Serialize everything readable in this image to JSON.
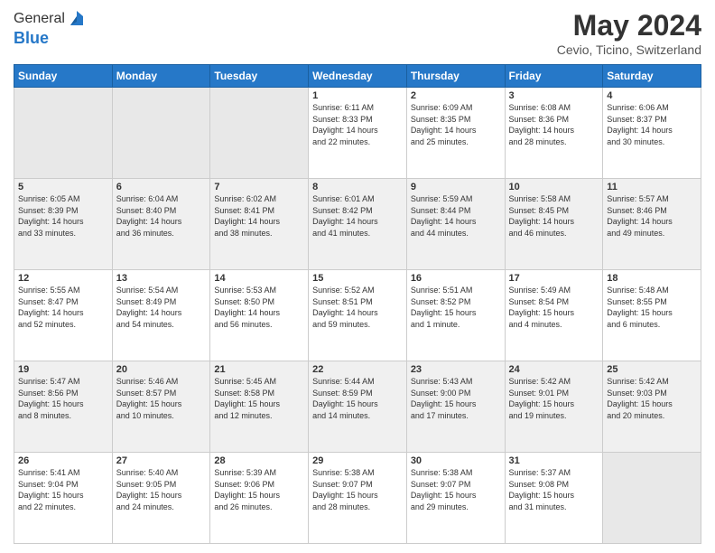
{
  "logo": {
    "line1": "General",
    "line2": "Blue"
  },
  "title": "May 2024",
  "subtitle": "Cevio, Ticino, Switzerland",
  "days_of_week": [
    "Sunday",
    "Monday",
    "Tuesday",
    "Wednesday",
    "Thursday",
    "Friday",
    "Saturday"
  ],
  "weeks": [
    [
      {
        "day": "",
        "info": ""
      },
      {
        "day": "",
        "info": ""
      },
      {
        "day": "",
        "info": ""
      },
      {
        "day": "1",
        "info": "Sunrise: 6:11 AM\nSunset: 8:33 PM\nDaylight: 14 hours\nand 22 minutes."
      },
      {
        "day": "2",
        "info": "Sunrise: 6:09 AM\nSunset: 8:35 PM\nDaylight: 14 hours\nand 25 minutes."
      },
      {
        "day": "3",
        "info": "Sunrise: 6:08 AM\nSunset: 8:36 PM\nDaylight: 14 hours\nand 28 minutes."
      },
      {
        "day": "4",
        "info": "Sunrise: 6:06 AM\nSunset: 8:37 PM\nDaylight: 14 hours\nand 30 minutes."
      }
    ],
    [
      {
        "day": "5",
        "info": "Sunrise: 6:05 AM\nSunset: 8:39 PM\nDaylight: 14 hours\nand 33 minutes."
      },
      {
        "day": "6",
        "info": "Sunrise: 6:04 AM\nSunset: 8:40 PM\nDaylight: 14 hours\nand 36 minutes."
      },
      {
        "day": "7",
        "info": "Sunrise: 6:02 AM\nSunset: 8:41 PM\nDaylight: 14 hours\nand 38 minutes."
      },
      {
        "day": "8",
        "info": "Sunrise: 6:01 AM\nSunset: 8:42 PM\nDaylight: 14 hours\nand 41 minutes."
      },
      {
        "day": "9",
        "info": "Sunrise: 5:59 AM\nSunset: 8:44 PM\nDaylight: 14 hours\nand 44 minutes."
      },
      {
        "day": "10",
        "info": "Sunrise: 5:58 AM\nSunset: 8:45 PM\nDaylight: 14 hours\nand 46 minutes."
      },
      {
        "day": "11",
        "info": "Sunrise: 5:57 AM\nSunset: 8:46 PM\nDaylight: 14 hours\nand 49 minutes."
      }
    ],
    [
      {
        "day": "12",
        "info": "Sunrise: 5:55 AM\nSunset: 8:47 PM\nDaylight: 14 hours\nand 52 minutes."
      },
      {
        "day": "13",
        "info": "Sunrise: 5:54 AM\nSunset: 8:49 PM\nDaylight: 14 hours\nand 54 minutes."
      },
      {
        "day": "14",
        "info": "Sunrise: 5:53 AM\nSunset: 8:50 PM\nDaylight: 14 hours\nand 56 minutes."
      },
      {
        "day": "15",
        "info": "Sunrise: 5:52 AM\nSunset: 8:51 PM\nDaylight: 14 hours\nand 59 minutes."
      },
      {
        "day": "16",
        "info": "Sunrise: 5:51 AM\nSunset: 8:52 PM\nDaylight: 15 hours\nand 1 minute."
      },
      {
        "day": "17",
        "info": "Sunrise: 5:49 AM\nSunset: 8:54 PM\nDaylight: 15 hours\nand 4 minutes."
      },
      {
        "day": "18",
        "info": "Sunrise: 5:48 AM\nSunset: 8:55 PM\nDaylight: 15 hours\nand 6 minutes."
      }
    ],
    [
      {
        "day": "19",
        "info": "Sunrise: 5:47 AM\nSunset: 8:56 PM\nDaylight: 15 hours\nand 8 minutes."
      },
      {
        "day": "20",
        "info": "Sunrise: 5:46 AM\nSunset: 8:57 PM\nDaylight: 15 hours\nand 10 minutes."
      },
      {
        "day": "21",
        "info": "Sunrise: 5:45 AM\nSunset: 8:58 PM\nDaylight: 15 hours\nand 12 minutes."
      },
      {
        "day": "22",
        "info": "Sunrise: 5:44 AM\nSunset: 8:59 PM\nDaylight: 15 hours\nand 14 minutes."
      },
      {
        "day": "23",
        "info": "Sunrise: 5:43 AM\nSunset: 9:00 PM\nDaylight: 15 hours\nand 17 minutes."
      },
      {
        "day": "24",
        "info": "Sunrise: 5:42 AM\nSunset: 9:01 PM\nDaylight: 15 hours\nand 19 minutes."
      },
      {
        "day": "25",
        "info": "Sunrise: 5:42 AM\nSunset: 9:03 PM\nDaylight: 15 hours\nand 20 minutes."
      }
    ],
    [
      {
        "day": "26",
        "info": "Sunrise: 5:41 AM\nSunset: 9:04 PM\nDaylight: 15 hours\nand 22 minutes."
      },
      {
        "day": "27",
        "info": "Sunrise: 5:40 AM\nSunset: 9:05 PM\nDaylight: 15 hours\nand 24 minutes."
      },
      {
        "day": "28",
        "info": "Sunrise: 5:39 AM\nSunset: 9:06 PM\nDaylight: 15 hours\nand 26 minutes."
      },
      {
        "day": "29",
        "info": "Sunrise: 5:38 AM\nSunset: 9:07 PM\nDaylight: 15 hours\nand 28 minutes."
      },
      {
        "day": "30",
        "info": "Sunrise: 5:38 AM\nSunset: 9:07 PM\nDaylight: 15 hours\nand 29 minutes."
      },
      {
        "day": "31",
        "info": "Sunrise: 5:37 AM\nSunset: 9:08 PM\nDaylight: 15 hours\nand 31 minutes."
      },
      {
        "day": "",
        "info": ""
      }
    ]
  ]
}
